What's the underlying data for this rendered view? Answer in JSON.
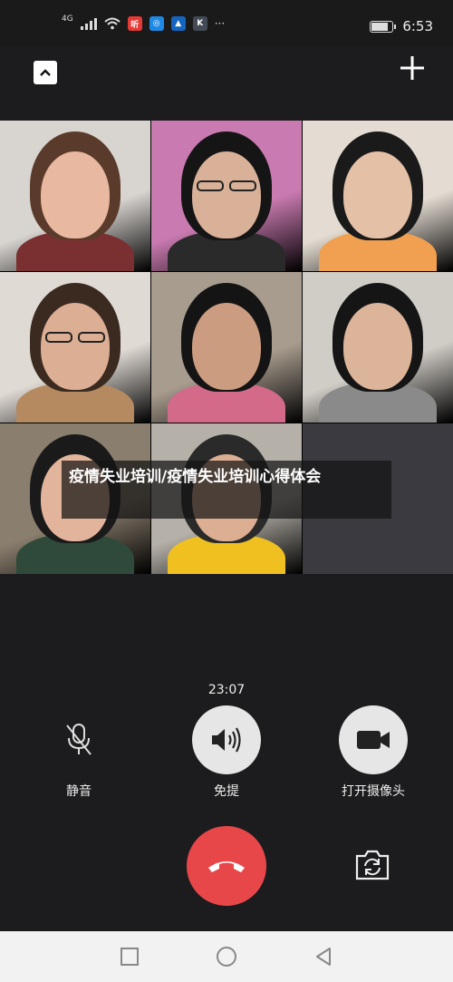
{
  "status_bar": {
    "network_label": "4G",
    "wifi_label": "\u0001",
    "app_badges": [
      {
        "text": "听",
        "color": "#e53935"
      },
      {
        "text": "◎",
        "color": "#1e88e5"
      },
      {
        "text": "▲",
        "color": "#1565c0"
      },
      {
        "text": "K",
        "color": "#444a55"
      }
    ],
    "more": "···",
    "time": "6:53",
    "battery_level": 0.82
  },
  "call": {
    "title": "疫情失业培训/疫情失业培训心得体会",
    "timer": "23:07",
    "mute_label": "静音",
    "speaker_label": "免提",
    "camera_label": "打开摄像头"
  },
  "participants": [
    {
      "bg": "#d8d4d0",
      "skin": "#e8b8a0",
      "hair": "#5a3a2a",
      "shirt": "#7a3030"
    },
    {
      "bg": "#c97ab0",
      "skin": "#d9b098",
      "hair": "#151515",
      "shirt": "#2a2a2a",
      "glasses": true
    },
    {
      "bg": "#e4dcd2",
      "skin": "#e3c0a6",
      "hair": "#1a1a1a",
      "shirt": "#f0a050"
    },
    {
      "bg": "#e0dad4",
      "skin": "#dcae94",
      "hair": "#3a2a20",
      "shirt": "#b58a60",
      "glasses": true
    },
    {
      "bg": "#a89c8e",
      "skin": "#cc9c80",
      "hair": "#141414",
      "shirt": "#d36a8a"
    },
    {
      "bg": "#d0ccc6",
      "skin": "#dcb49a",
      "hair": "#151515",
      "shirt": "#8a8a8a"
    },
    {
      "bg": "#8a7e6e",
      "skin": "#e2b49c",
      "hair": "#1a1a1a",
      "shirt": "#2f4a3a"
    },
    {
      "bg": "#b5b0a8",
      "skin": "#dcaf92",
      "hair": "#2a2a2a",
      "shirt": "#f0c020"
    }
  ],
  "colors": {
    "hangup": "#e8474a",
    "background": "#1c1c1e",
    "button": "#e6e6e6"
  }
}
